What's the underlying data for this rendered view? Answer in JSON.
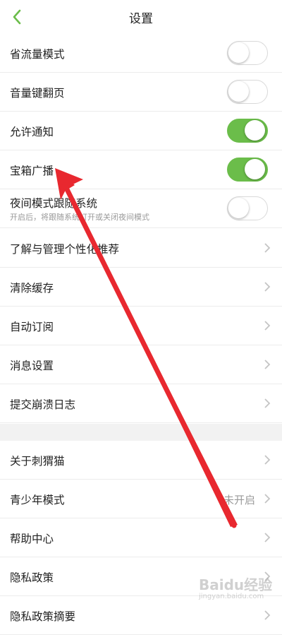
{
  "header": {
    "title": "设置",
    "back_icon": "chevron-left-icon"
  },
  "colors": {
    "accent": "#6bbd4a",
    "divider": "#ececec",
    "arrow": "#e8282f"
  },
  "toggles": [
    {
      "label": "省流量模式",
      "on": false
    },
    {
      "label": "音量键翻页",
      "on": false
    },
    {
      "label": "允许通知",
      "on": true
    },
    {
      "label": "宝箱广播",
      "on": true
    },
    {
      "label": "夜间模式跟随系统",
      "sublabel": "开启后，将跟随系统打开或关闭夜间模式",
      "on": false
    }
  ],
  "links": [
    {
      "label": "了解与管理个性化推荐"
    },
    {
      "label": "清除缓存"
    },
    {
      "label": "自动订阅"
    },
    {
      "label": "消息设置"
    },
    {
      "label": "提交崩溃日志"
    }
  ],
  "links2": [
    {
      "label": "关于刺猬猫"
    },
    {
      "label": "青少年模式",
      "value": "未开启"
    },
    {
      "label": "帮助中心"
    },
    {
      "label": "隐私政策"
    },
    {
      "label": "隐私政策摘要"
    }
  ],
  "watermark": {
    "text": "Baidu经验",
    "sub": "jingyan.baidu.com"
  }
}
